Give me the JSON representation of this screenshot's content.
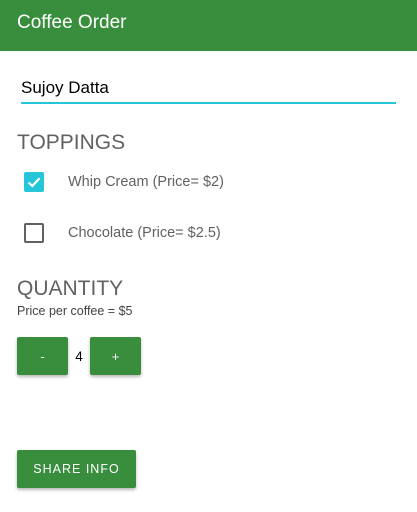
{
  "app_bar": {
    "title": "Coffee Order",
    "color": "#388e3c"
  },
  "name_input": {
    "value": "Sujoy Datta",
    "underline_color": "#26c6da"
  },
  "toppings": {
    "heading": "TOPPINGS",
    "items": [
      {
        "label": "Whip Cream (Price= $2)",
        "checked": true,
        "icon": "check-icon"
      },
      {
        "label": "Chocolate (Price= $2.5)",
        "checked": false
      }
    ],
    "checked_color": "#26c6da"
  },
  "quantity": {
    "heading": "QUANTITY",
    "price_note": "Price per coffee = $5",
    "decrement_label": "-",
    "increment_label": "+",
    "value": "4"
  },
  "share_button": {
    "label": "SHARE INFO"
  }
}
